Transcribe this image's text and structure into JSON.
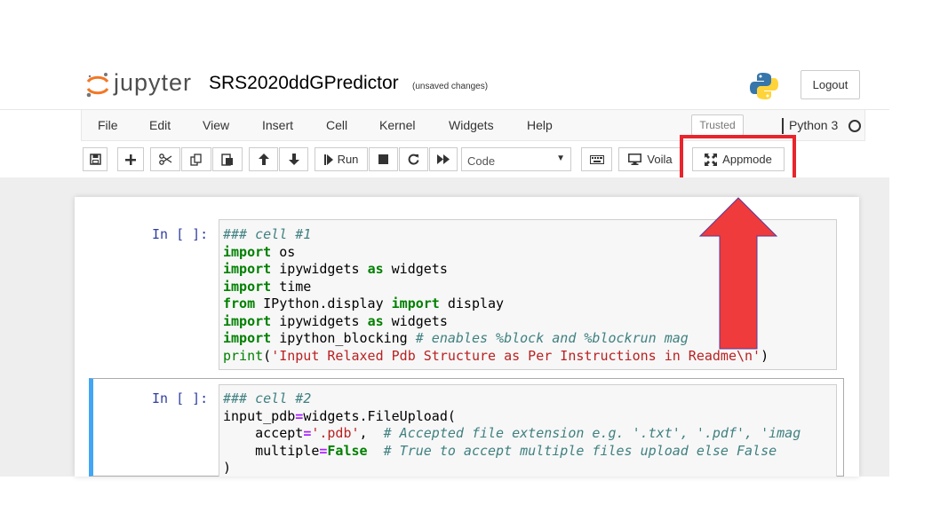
{
  "header": {
    "logo_text": "jupyter",
    "notebook_title": "SRS2020ddGPredictor",
    "save_status": "(unsaved changes)",
    "logout_label": "Logout"
  },
  "menubar": {
    "items": [
      "File",
      "Edit",
      "View",
      "Insert",
      "Cell",
      "Kernel",
      "Widgets",
      "Help"
    ],
    "trusted_label": "Trusted",
    "kernel_name": "Python 3"
  },
  "toolbar": {
    "run_label": "Run",
    "cell_type": "Code",
    "voila_label": "Voila",
    "appmode_label": "Appmode",
    "icons": [
      "save-icon",
      "plus-icon",
      "cut-icon",
      "copy-icon",
      "paste-icon",
      "arrow-up-icon",
      "arrow-down-icon",
      "step-forward-icon",
      "stop-icon",
      "restart-icon",
      "fast-forward-icon",
      "keyboard-icon",
      "desktop-icon",
      "expand-icon"
    ]
  },
  "annotation": {
    "highlight_color": "#e8242c",
    "arrow_color": "#ef3b3b"
  },
  "cells": [
    {
      "prompt": "In [ ]:",
      "lines": [
        [
          {
            "t": "### cell #1",
            "c": "cm"
          }
        ],
        [
          {
            "t": "import",
            "c": "kw"
          },
          {
            "t": " os",
            "c": ""
          }
        ],
        [
          {
            "t": "import",
            "c": "kw"
          },
          {
            "t": " ipywidgets ",
            "c": ""
          },
          {
            "t": "as",
            "c": "kw"
          },
          {
            "t": " widgets",
            "c": ""
          }
        ],
        [
          {
            "t": "import",
            "c": "kw"
          },
          {
            "t": " time",
            "c": ""
          }
        ],
        [
          {
            "t": "from",
            "c": "kw"
          },
          {
            "t": " IPython.display ",
            "c": ""
          },
          {
            "t": "import",
            "c": "kw"
          },
          {
            "t": " display",
            "c": ""
          }
        ],
        [
          {
            "t": "import",
            "c": "kw"
          },
          {
            "t": " ipywidgets ",
            "c": ""
          },
          {
            "t": "as",
            "c": "kw"
          },
          {
            "t": " widgets",
            "c": ""
          }
        ],
        [
          {
            "t": "import",
            "c": "kw"
          },
          {
            "t": " ipython_blocking ",
            "c": ""
          },
          {
            "t": "# enables %block and %blockrun mag",
            "c": "cm"
          }
        ],
        [
          {
            "t": "print",
            "c": "bi"
          },
          {
            "t": "(",
            "c": ""
          },
          {
            "t": "'Input Relaxed Pdb Structure as Per Instructions in Readme\\n'",
            "c": "str"
          },
          {
            "t": ")",
            "c": ""
          }
        ]
      ]
    },
    {
      "prompt": "In [ ]:",
      "lines": [
        [
          {
            "t": "### cell #2",
            "c": "cm"
          }
        ],
        [
          {
            "t": "input_pdb",
            "c": ""
          },
          {
            "t": "=",
            "c": "op"
          },
          {
            "t": "widgets.FileUpload(",
            "c": ""
          }
        ],
        [
          {
            "t": "    accept",
            "c": ""
          },
          {
            "t": "=",
            "c": "op"
          },
          {
            "t": "'.pdb'",
            "c": "str"
          },
          {
            "t": ",  ",
            "c": ""
          },
          {
            "t": "# Accepted file extension e.g. '.txt', '.pdf', 'imag",
            "c": "cm"
          }
        ],
        [
          {
            "t": "    multiple",
            "c": ""
          },
          {
            "t": "=",
            "c": "op"
          },
          {
            "t": "False",
            "c": "kw"
          },
          {
            "t": "  ",
            "c": ""
          },
          {
            "t": "# True to accept multiple files upload else False",
            "c": "cm"
          }
        ],
        [
          {
            "t": ")",
            "c": ""
          }
        ]
      ]
    }
  ]
}
